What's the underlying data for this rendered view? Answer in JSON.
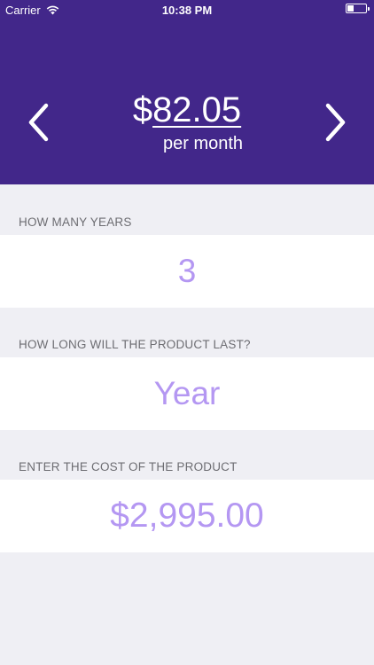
{
  "status_bar": {
    "carrier": "Carrier",
    "time": "10:38 PM"
  },
  "header": {
    "currency_symbol": "$",
    "amount": "82.05",
    "period": "per month",
    "background_color": "#42278a"
  },
  "fields": {
    "years": {
      "label": "HOW MANY YEARS",
      "value": "3"
    },
    "duration": {
      "label": "HOW LONG WILL THE PRODUCT LAST?",
      "value": "Year"
    },
    "cost": {
      "label": "ENTER THE COST OF THE PRODUCT",
      "value": "$2,995.00"
    }
  },
  "colors": {
    "accent": "#b497f2",
    "label": "#6d6d72",
    "background": "#efeff4"
  },
  "icons": {
    "prev": "chevron-left-icon",
    "next": "chevron-right-icon",
    "wifi": "wifi-icon",
    "battery": "battery-icon"
  }
}
